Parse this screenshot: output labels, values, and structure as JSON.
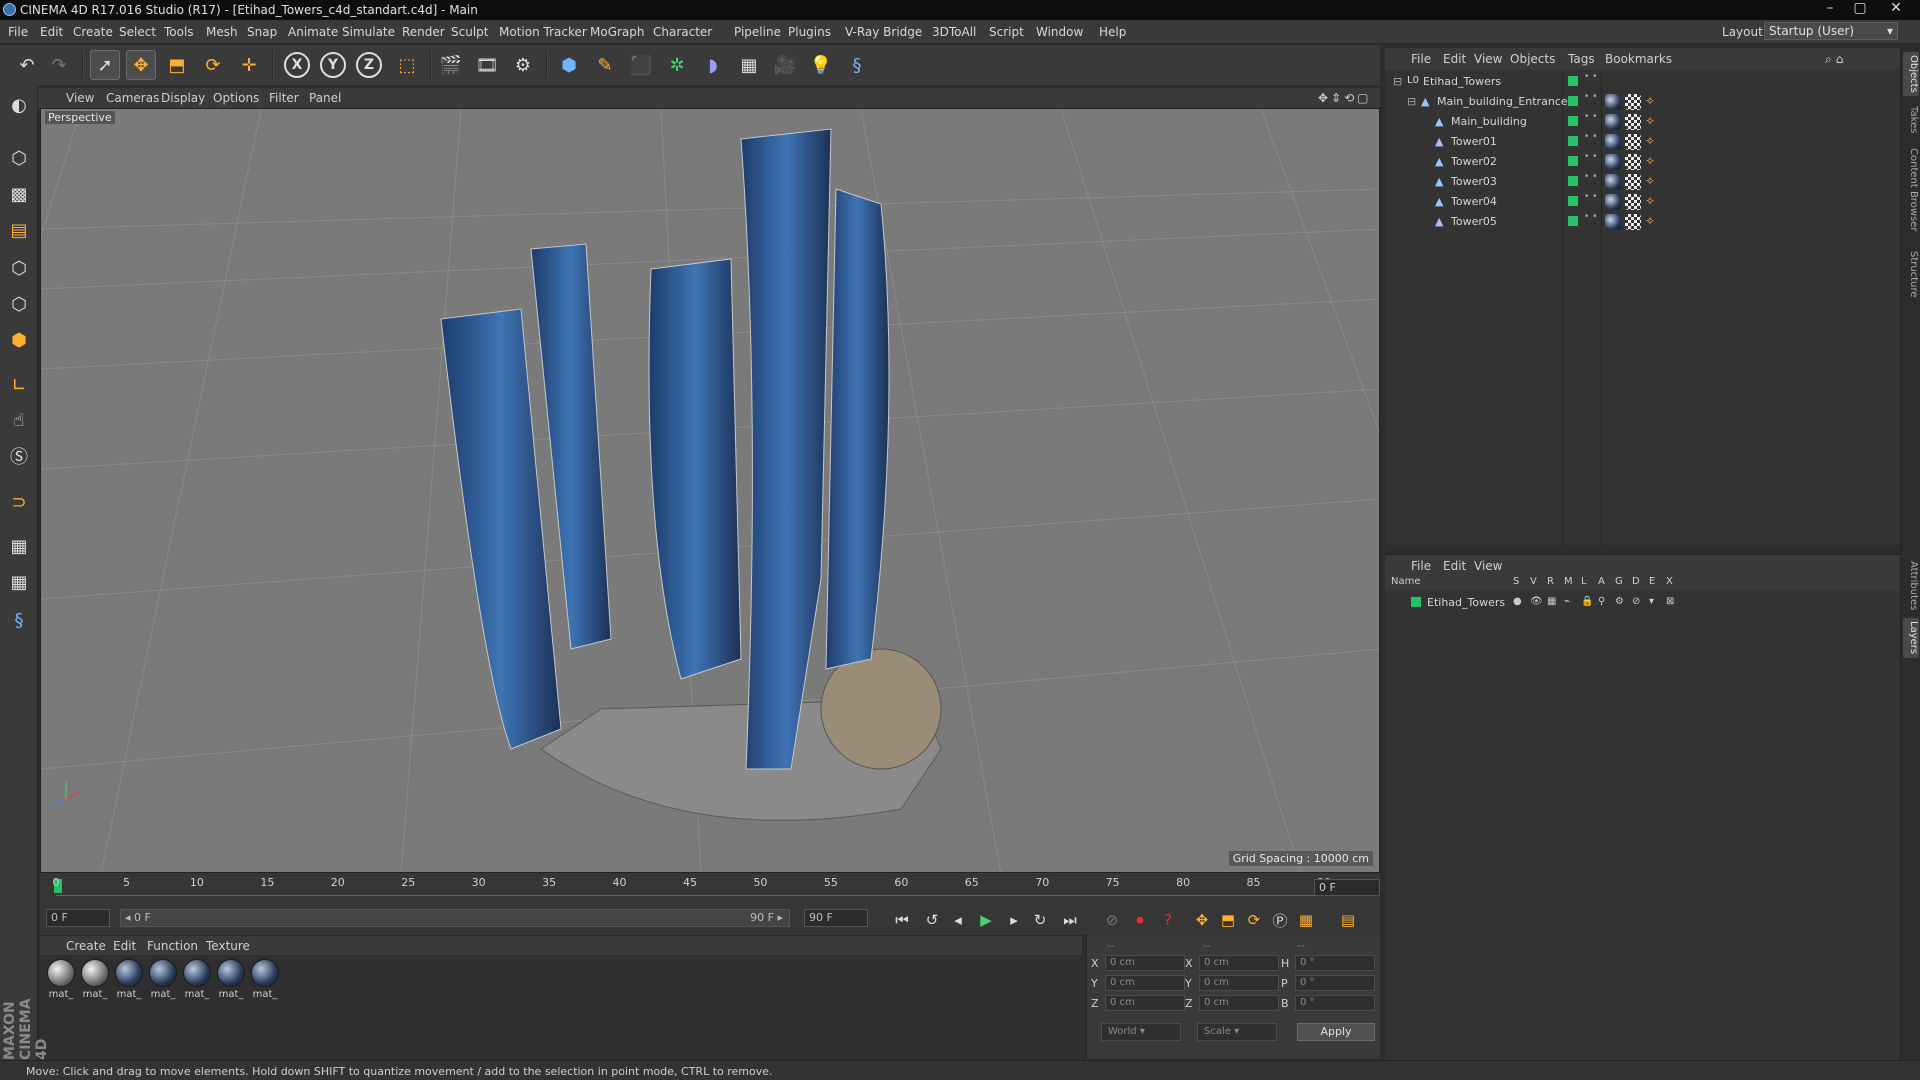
{
  "window": {
    "title": "CINEMA 4D R17.016 Studio (R17) - [Etihad_Towers_c4d_standart.c4d] - Main",
    "controls": [
      "–",
      "▢",
      "✕"
    ]
  },
  "menubar": {
    "items": [
      "File",
      "Edit",
      "Create",
      "Select",
      "Tools",
      "Mesh",
      "Snap",
      "Animate",
      "Simulate",
      "Render",
      "Sculpt",
      "Motion Tracker",
      "MoGraph",
      "Character",
      "Pipeline",
      "Plugins",
      "V-Ray Bridge",
      "3DToAll",
      "Script",
      "Window",
      "Help"
    ],
    "layout_label": "Layout:",
    "layout_value": "Startup (User)"
  },
  "toolbar": {
    "icons": [
      "undo-icon",
      "redo-icon",
      "select-icon",
      "move-icon",
      "scale-icon",
      "rotate-icon",
      "transform-icon",
      "x-axis-icon",
      "y-axis-icon",
      "z-axis-icon",
      "coordinate-system-icon",
      "render-view-icon",
      "render-picture-viewer-icon",
      "render-settings-icon",
      "cube-icon",
      "pen-icon",
      "subdivision-icon",
      "array-icon",
      "deformer-icon",
      "floor-icon",
      "camera-icon",
      "light-icon",
      "python-icon"
    ],
    "axis_labels": [
      "X",
      "Y",
      "Z"
    ]
  },
  "lefttools": {
    "icons": [
      "make-editable-icon",
      "model-mode-icon",
      "texture-mode-icon",
      "workplane-icon",
      "points-mode-icon",
      "edges-mode-icon",
      "polygons-mode-icon",
      "axis-mode-icon",
      "tweak-icon",
      "solo-icon",
      "magnet-icon",
      "snap-icon",
      "snap-settings-icon",
      "python-icon"
    ]
  },
  "viewport": {
    "menu": [
      "View",
      "Cameras",
      "Display",
      "Options",
      "Filter",
      "Panel"
    ],
    "label": "Perspective",
    "grid_spacing": "Grid Spacing : 10000 cm"
  },
  "timeline": {
    "ticks": [
      "0",
      "5",
      "10",
      "15",
      "20",
      "25",
      "30",
      "35",
      "40",
      "45",
      "50",
      "55",
      "60",
      "65",
      "70",
      "75",
      "80",
      "85",
      "90"
    ],
    "current_frame": "0 F",
    "start_field": "0 F",
    "range_start": "◂ 0 F",
    "range_end": "90 F ▸",
    "end_field": "90 F"
  },
  "materials": {
    "menu": [
      "Create",
      "Edit",
      "Function",
      "Texture"
    ],
    "items": [
      {
        "label": "mat_",
        "style": "grey"
      },
      {
        "label": "mat_",
        "style": "grey"
      },
      {
        "label": "mat_",
        "style": "blue"
      },
      {
        "label": "mat_",
        "style": "blue"
      },
      {
        "label": "mat_",
        "style": "blue"
      },
      {
        "label": "mat_",
        "style": "blue"
      },
      {
        "label": "mat_",
        "style": "blue"
      }
    ]
  },
  "coordinates": {
    "header": [
      "--",
      "--",
      "--"
    ],
    "rows": [
      {
        "a": "X",
        "av": "0 cm",
        "b": "X",
        "bv": "0 cm",
        "c": "H",
        "cv": "0 °"
      },
      {
        "a": "Y",
        "av": "0 cm",
        "b": "Y",
        "bv": "0 cm",
        "c": "P",
        "cv": "0 °"
      },
      {
        "a": "Z",
        "av": "0 cm",
        "b": "Z",
        "bv": "0 cm",
        "c": "B",
        "cv": "0 °"
      }
    ],
    "space": "World",
    "mode": "Scale",
    "apply": "Apply"
  },
  "status": "Move: Click and drag to move elements. Hold down SHIFT to quantize movement / add to the selection in point mode, CTRL to remove.",
  "maxon": "MAXON CINEMA 4D",
  "objects": {
    "menu": [
      "File",
      "Edit",
      "View",
      "Objects",
      "Tags",
      "Bookmarks"
    ],
    "tree": [
      {
        "name": "Etihad_Towers",
        "indent": 0,
        "icon": "null-icon"
      },
      {
        "name": "Main_building_Entrance",
        "indent": 1,
        "icon": "polygon-object-icon"
      },
      {
        "name": "Main_building",
        "indent": 2,
        "icon": "polygon-object-icon"
      },
      {
        "name": "Tower01",
        "indent": 2,
        "icon": "polygon-object-icon"
      },
      {
        "name": "Tower02",
        "indent": 2,
        "icon": "polygon-object-icon"
      },
      {
        "name": "Tower03",
        "indent": 2,
        "icon": "polygon-object-icon"
      },
      {
        "name": "Tower04",
        "indent": 2,
        "icon": "polygon-object-icon"
      },
      {
        "name": "Tower05",
        "indent": 2,
        "icon": "polygon-object-icon"
      }
    ]
  },
  "layers": {
    "menu": [
      "File",
      "Edit",
      "View"
    ],
    "columns": [
      "Name",
      "S",
      "V",
      "R",
      "M",
      "L",
      "A",
      "G",
      "D",
      "E",
      "X"
    ],
    "rows": [
      {
        "name": "Etihad_Towers",
        "color": "#26c26a"
      }
    ]
  },
  "right_tabs": [
    "Objects",
    "Takes",
    "Content Browser",
    "Structure",
    "Attributes",
    "Layers"
  ],
  "colors": {
    "accent_green": "#26c26a",
    "viewport_bg": "#7a7a7a",
    "panel_bg": "#3a3a3a"
  }
}
